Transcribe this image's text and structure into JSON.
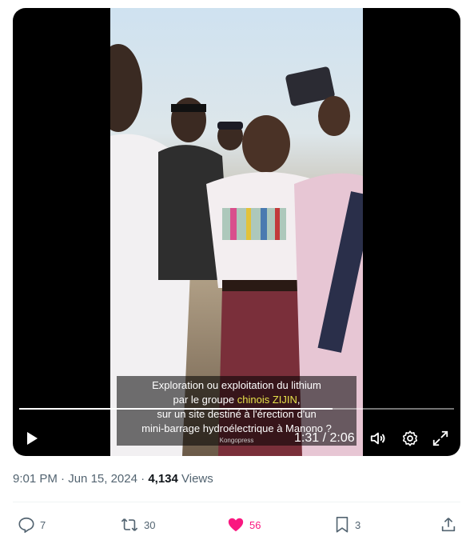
{
  "video": {
    "subtitle_line1": "Exploration ou exploitation du lithium",
    "subtitle_line2_prefix": "par le groupe ",
    "subtitle_line2_highlight": "chinois ZIJIN",
    "subtitle_line2_suffix": ",",
    "subtitle_line3": "sur un site destiné à l'érection d'un",
    "subtitle_line4": "mini-barrage hydroélectrique à Manono ?",
    "source_watermark": "Kongopress",
    "time_display": "1:31 / 2:06",
    "progress": 0.72
  },
  "tweet": {
    "time": "9:01 PM",
    "separator": " · ",
    "date": "Jun 15, 2024",
    "views_count": "4,134",
    "views_label": " Views"
  },
  "actions": {
    "replies": "7",
    "reposts": "30",
    "likes": "56",
    "bookmarks": "3"
  },
  "colors": {
    "like_active": "#f91880",
    "highlight": "#e6e14a"
  },
  "icons": [
    "play-icon",
    "volume-icon",
    "settings-gear-icon",
    "fullscreen-icon",
    "reply-icon",
    "repost-icon",
    "heart-icon",
    "bookmark-icon",
    "share-icon"
  ]
}
